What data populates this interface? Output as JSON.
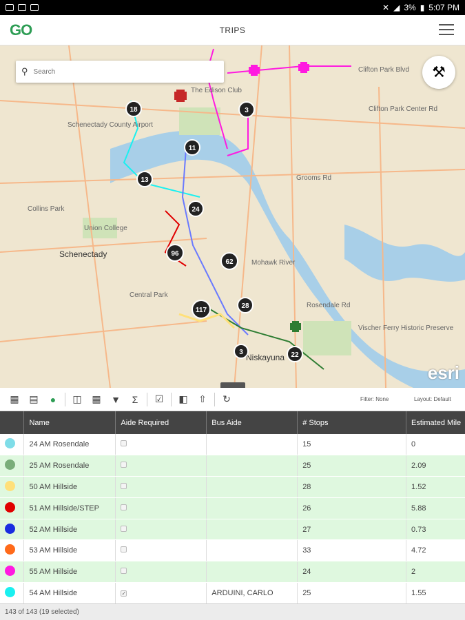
{
  "status_bar": {
    "battery": "3%",
    "time": "5:07 PM"
  },
  "app": {
    "logo": "GO",
    "title": "TRIPS"
  },
  "map": {
    "search_placeholder": "Search",
    "attribution": "esri",
    "clusters": [
      "18",
      "3",
      "11",
      "13",
      "24",
      "96",
      "62",
      "28",
      "117",
      "3",
      "22"
    ],
    "labels": [
      "Schenectady County Airport",
      "The Edison Club",
      "Clifton Park Blvd",
      "Clifton Park Center Rd",
      "Grooms Rd",
      "Schenectady",
      "Union College",
      "Collins Park",
      "Central Park",
      "Niskayuna",
      "Vischer Ferry Historic Preserve",
      "Rosendale Rd",
      "Mohawk River"
    ]
  },
  "toolbar": {
    "filter_label": "Filter: None",
    "layout_label": "Layout: Default"
  },
  "table": {
    "columns": [
      "",
      "Name",
      "Aide Required",
      "Bus Aide",
      "# Stops",
      "Estimated Mile"
    ],
    "rows": [
      {
        "color": "#7fdde8",
        "name": "24 AM Rosendale",
        "aide_required": false,
        "bus_aide": "",
        "stops": "15",
        "miles": "0",
        "selected": false
      },
      {
        "color": "#7aae7a",
        "name": "25 AM Rosendale",
        "aide_required": false,
        "bus_aide": "",
        "stops": "25",
        "miles": "2.09",
        "selected": true
      },
      {
        "color": "#ffe07a",
        "name": "50 AM Hillside",
        "aide_required": false,
        "bus_aide": "",
        "stops": "28",
        "miles": "1.52",
        "selected": true
      },
      {
        "color": "#e00000",
        "name": "51 AM Hillside/STEP",
        "aide_required": false,
        "bus_aide": "",
        "stops": "26",
        "miles": "5.88",
        "selected": true
      },
      {
        "color": "#1a2de0",
        "name": "52 AM Hillside",
        "aide_required": false,
        "bus_aide": "",
        "stops": "27",
        "miles": "0.73",
        "selected": true
      },
      {
        "color": "#ff6a1a",
        "name": "53 AM Hillside",
        "aide_required": false,
        "bus_aide": "",
        "stops": "33",
        "miles": "4.72",
        "selected": false
      },
      {
        "color": "#ff1ae0",
        "name": "55 AM Hillside",
        "aide_required": false,
        "bus_aide": "",
        "stops": "24",
        "miles": "2",
        "selected": true
      },
      {
        "color": "#1af0f0",
        "name": "54 AM Hillside",
        "aide_required": true,
        "bus_aide": "ARDUINI, CARLO",
        "stops": "25",
        "miles": "1.55",
        "selected": false
      }
    ]
  },
  "footer": {
    "count": "143 of 143 (19 selected)"
  }
}
